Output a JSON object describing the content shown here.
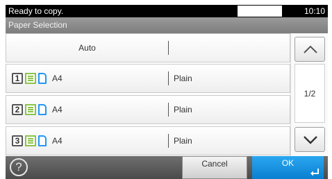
{
  "status": {
    "message": "Ready to copy.",
    "time": "10:10"
  },
  "title": "Paper Selection",
  "auto_row": {
    "label": "Auto",
    "type": ""
  },
  "rows": [
    {
      "cassette": "1",
      "size": "A4",
      "type": "Plain"
    },
    {
      "cassette": "2",
      "size": "A4",
      "type": "Plain"
    },
    {
      "cassette": "3",
      "size": "A4",
      "type": "Plain"
    }
  ],
  "scroll": {
    "page": "1/2",
    "up_icon": "chevron-up-icon",
    "down_icon": "chevron-down-icon"
  },
  "bottom": {
    "help_glyph": "?",
    "cancel_label": "Cancel",
    "ok_label": "OK",
    "ok_icon": "enter-arrow-icon"
  },
  "colors": {
    "ok_blue": "#1592e0",
    "stack_green": "#8bc34a",
    "sheet_blue": "#2196f3"
  }
}
